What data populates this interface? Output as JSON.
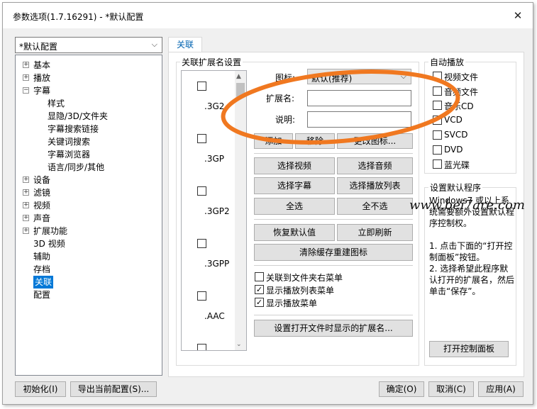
{
  "window": {
    "title": "参数选项(1.7.16291) - *默认配置",
    "close_glyph": "✕"
  },
  "profile": {
    "value": "*默认配置"
  },
  "tree": {
    "items": [
      {
        "label": "基本",
        "expander": "+"
      },
      {
        "label": "播放",
        "expander": "+"
      },
      {
        "label": "字幕",
        "expander": "−"
      },
      {
        "label": "样式"
      },
      {
        "label": "显隐/3D/文件夹"
      },
      {
        "label": "字幕搜索链接"
      },
      {
        "label": "关键词搜索"
      },
      {
        "label": "字幕浏览器"
      },
      {
        "label": "语言/同步/其他"
      },
      {
        "label": "设备",
        "expander": "+"
      },
      {
        "label": "滤镜",
        "expander": "+"
      },
      {
        "label": "视频",
        "expander": "+"
      },
      {
        "label": "声音",
        "expander": "+"
      },
      {
        "label": "扩展功能",
        "expander": "+"
      },
      {
        "label": "3D 视频"
      },
      {
        "label": "辅助"
      },
      {
        "label": "存档"
      },
      {
        "label": "关联",
        "selected": true
      },
      {
        "label": "配置"
      }
    ]
  },
  "tab": {
    "label": "关联"
  },
  "assoc": {
    "group_title": "关联扩展名设置",
    "ext_items": [
      ".3G2",
      ".3GP",
      ".3GP2",
      ".3GPP",
      ".AAC"
    ],
    "icon_label": "图标:",
    "icon_value": "默认(推荐)",
    "ext_label": "扩展名:",
    "desc_label": "说明:",
    "buttons": {
      "add": "添加",
      "remove": "移除",
      "change_icon": "更改图标...",
      "select_video": "选择视频",
      "select_audio": "选择音频",
      "select_subtitle": "选择字幕",
      "select_playlist": "选择播放列表",
      "select_all": "全选",
      "select_none": "全不选",
      "restore_default": "恢复默认值",
      "refresh_now": "立即刷新",
      "clear_cache": "清除缓存重建图标",
      "set_ext": "设置打开文件时显示的扩展名..."
    },
    "checks": [
      {
        "label": "关联到文件夹右菜单",
        "checked": false
      },
      {
        "label": "显示播放列表菜单",
        "checked": true
      },
      {
        "label": "显示播放菜单",
        "checked": true
      }
    ]
  },
  "autoplay": {
    "title": "自动播放",
    "items": [
      "视频文件",
      "音频文件",
      "音乐CD",
      "VCD",
      "SVCD",
      "DVD",
      "蓝光碟"
    ]
  },
  "default_program": {
    "title": "设置默认程序",
    "text": "Windows7 或以上系统需要额外设置默认程序控制权。\n\n1. 点击下面的“打开控制面板”按钮。\n2. 选择希望此程序默认打开的扩展名，然后单击“保存”。",
    "button": "打开控制面板"
  },
  "watermark": "www.bei7are.com",
  "footer": {
    "init": "初始化(I)",
    "export": "导出当前配置(S)...",
    "ok": "确定(O)",
    "cancel": "取消(C)",
    "apply": "应用(A)"
  },
  "check_glyph": "✓",
  "colors": {
    "accent": "#0078d7",
    "annotation": "#f07820"
  }
}
